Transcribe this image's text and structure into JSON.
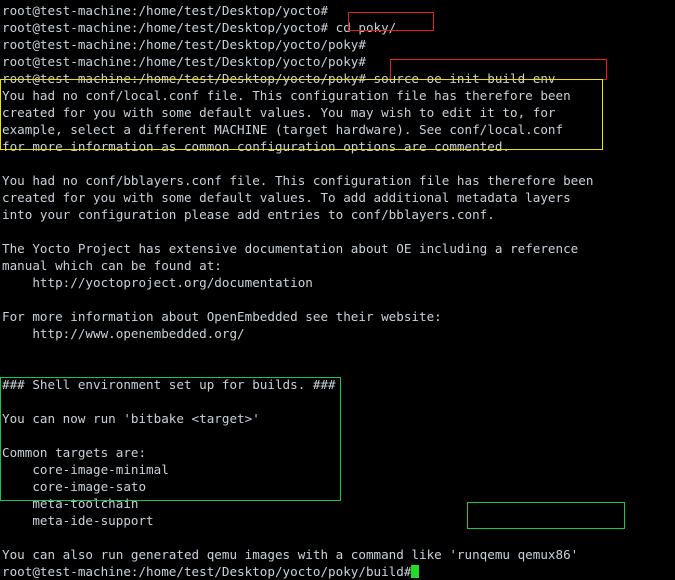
{
  "terminal": {
    "background_color": "#000000",
    "text_color": "#c9d1d9",
    "cursor_color": "#22dd22",
    "prompt_user_host_path_1": "root@test-machine:/home/test/Desktop/yocto#",
    "prompt_user_host_path_2": "root@test-machine:/home/test/Desktop/yocto/poky#",
    "prompt_final": "root@test-machine:/home/test/Desktop/yocto/poky/build#",
    "lines": [
      "root@test-machine:/home/test/Desktop/yocto#",
      "root@test-machine:/home/test/Desktop/yocto# cd poky/",
      "root@test-machine:/home/test/Desktop/yocto/poky#",
      "root@test-machine:/home/test/Desktop/yocto/poky#",
      "root@test-machine:/home/test/Desktop/yocto/poky# source oe-init-build-env",
      "You had no conf/local.conf file. This configuration file has therefore been",
      "created for you with some default values. You may wish to edit it to, for",
      "example, select a different MACHINE (target hardware). See conf/local.conf",
      "for more information as common configuration options are commented.",
      "",
      "You had no conf/bblayers.conf file. This configuration file has therefore been",
      "created for you with some default values. To add additional metadata layers",
      "into your configuration please add entries to conf/bblayers.conf.",
      "",
      "The Yocto Project has extensive documentation about OE including a reference",
      "manual which can be found at:",
      "    http://yoctoproject.org/documentation",
      "",
      "For more information about OpenEmbedded see their website:",
      "    http://www.openembedded.org/",
      "",
      "",
      "### Shell environment set up for builds. ###",
      "",
      "You can now run 'bitbake <target>'",
      "",
      "Common targets are:",
      "    core-image-minimal",
      "    core-image-sato",
      "    meta-toolchain",
      "    meta-ide-support",
      "",
      "You can also run generated qemu images with a command like 'runqemu qemux86'"
    ]
  },
  "commands": {
    "cd_poky": "cd poky/",
    "source_env": "source oe-init-build-env",
    "runqemu": "'runqemu qemux86'"
  },
  "annotations": [
    {
      "name": "cd-poky-highlight",
      "color": "#e81e1e",
      "label": "cd poky/"
    },
    {
      "name": "source-env-highlight",
      "color": "#e81e1e",
      "label": "source oe-init-build-env"
    },
    {
      "name": "local-conf-message-highlight",
      "color": "#f2e100",
      "label": "conf/local.conf notice"
    },
    {
      "name": "bitbake-targets-highlight",
      "color": "#19c54a",
      "label": "bitbake targets block"
    },
    {
      "name": "runqemu-highlight",
      "color": "#19c54a",
      "label": "'runqemu qemux86'"
    }
  ]
}
